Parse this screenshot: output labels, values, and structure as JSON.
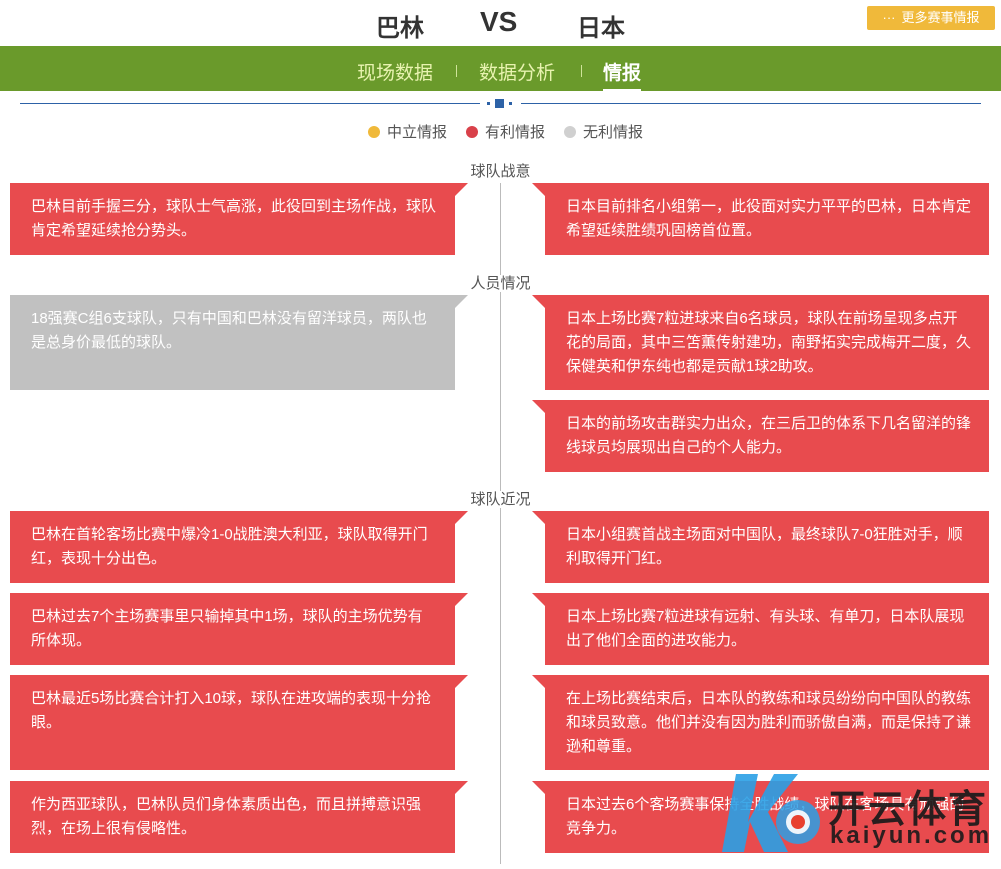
{
  "header": {
    "home_team": "巴林",
    "vs": "VS",
    "away_team": "日本",
    "more_button": "更多赛事情报",
    "more_dots": "···"
  },
  "nav": {
    "tabs": [
      "现场数据",
      "数据分析",
      "情报"
    ],
    "separator": "|",
    "active_index": 2
  },
  "legend": [
    {
      "label": "中立情报",
      "color": "#f0b93a"
    },
    {
      "label": "有利情报",
      "color": "#d9414a"
    },
    {
      "label": "无利情报",
      "color": "#d0d0d0"
    }
  ],
  "sections": [
    {
      "title": "球队战意",
      "left": [
        {
          "text": "巴林目前手握三分，球队士气高涨，此役回到主场作战，球队肯定希望延续抢分势头。",
          "type": "favorable"
        }
      ],
      "right": [
        {
          "text": "日本目前排名小组第一，此役面对实力平平的巴林，日本肯定希望延续胜绩巩固榜首位置。",
          "type": "favorable"
        }
      ]
    },
    {
      "title": "人员情况",
      "left": [
        {
          "text": "18强赛C组6支球队，只有中国和巴林没有留洋球员，两队也是总身价最低的球队。",
          "type": "unfavorable"
        }
      ],
      "right": [
        {
          "text": "日本上场比赛7粒进球来自6名球员，球队在前场呈现多点开花的局面，其中三笘薫传射建功，南野拓实完成梅开二度，久保健英和伊东纯也都是贡献1球2助攻。",
          "type": "favorable"
        },
        {
          "text": "日本的前场攻击群实力出众，在三后卫的体系下几名留洋的锋线球员均展现出自己的个人能力。",
          "type": "favorable"
        }
      ]
    },
    {
      "title": "球队近况",
      "left": [
        {
          "text": "巴林在首轮客场比赛中爆冷1-0战胜澳大利亚，球队取得开门红，表现十分出色。",
          "type": "favorable"
        },
        {
          "text": "巴林过去7个主场赛事里只输掉其中1场，球队的主场优势有所体现。",
          "type": "favorable"
        },
        {
          "text": "巴林最近5场比赛合计打入10球，球队在进攻端的表现十分抢眼。",
          "type": "favorable"
        },
        {
          "text": "作为西亚球队，巴林队员们身体素质出色，而且拼搏意识强烈，在场上很有侵略性。",
          "type": "favorable"
        }
      ],
      "right": [
        {
          "text": "日本小组赛首战主场面对中国队，最终球队7-0狂胜对手，顺利取得开门红。",
          "type": "favorable"
        },
        {
          "text": "日本上场比赛7粒进球有远射、有头球、有单刀，日本队展现出了他们全面的进攻能力。",
          "type": "favorable"
        },
        {
          "text": "在上场比赛结束后，日本队的教练和球员纷纷向中国队的教练和球员致意。他们并没有因为胜利而骄傲自满，而是保持了谦逊和尊重。",
          "type": "favorable"
        },
        {
          "text": "日本过去6个客场赛事保持全胜战绩，球队在客场具有顽强的竞争力。",
          "type": "favorable"
        }
      ]
    }
  ],
  "watermark": {
    "brand": "开云体育",
    "domain": "kaiyun.com",
    "colors": {
      "blue": "#2aa0e6",
      "red": "#e8402f",
      "dark": "#1a1a1a"
    }
  }
}
